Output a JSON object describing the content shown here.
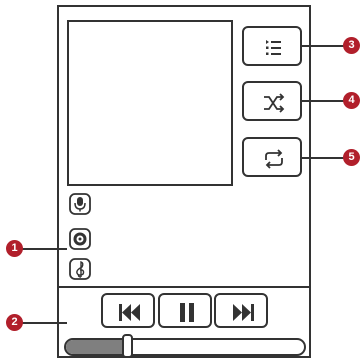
{
  "colors": {
    "callout_badge": "#b11f2b",
    "outline": "#333333",
    "progress_fill": "#7f7f7f"
  },
  "side_buttons": [
    {
      "icon": "playlist-icon"
    },
    {
      "icon": "shuffle-icon"
    },
    {
      "icon": "repeat-icon"
    }
  ],
  "status_icons": [
    {
      "icon": "microphone-icon"
    },
    {
      "icon": "record-icon"
    },
    {
      "icon": "treble-clef-icon"
    }
  ],
  "controls": [
    {
      "icon": "previous-track-icon"
    },
    {
      "icon": "pause-icon"
    },
    {
      "icon": "next-track-icon"
    }
  ],
  "progress": {
    "fraction": 0.24
  },
  "callouts": [
    {
      "label": "1",
      "target": "status-icons"
    },
    {
      "label": "2",
      "target": "player-controls"
    },
    {
      "label": "3",
      "target": "playlist-button"
    },
    {
      "label": "4",
      "target": "shuffle-button"
    },
    {
      "label": "5",
      "target": "repeat-button"
    }
  ]
}
